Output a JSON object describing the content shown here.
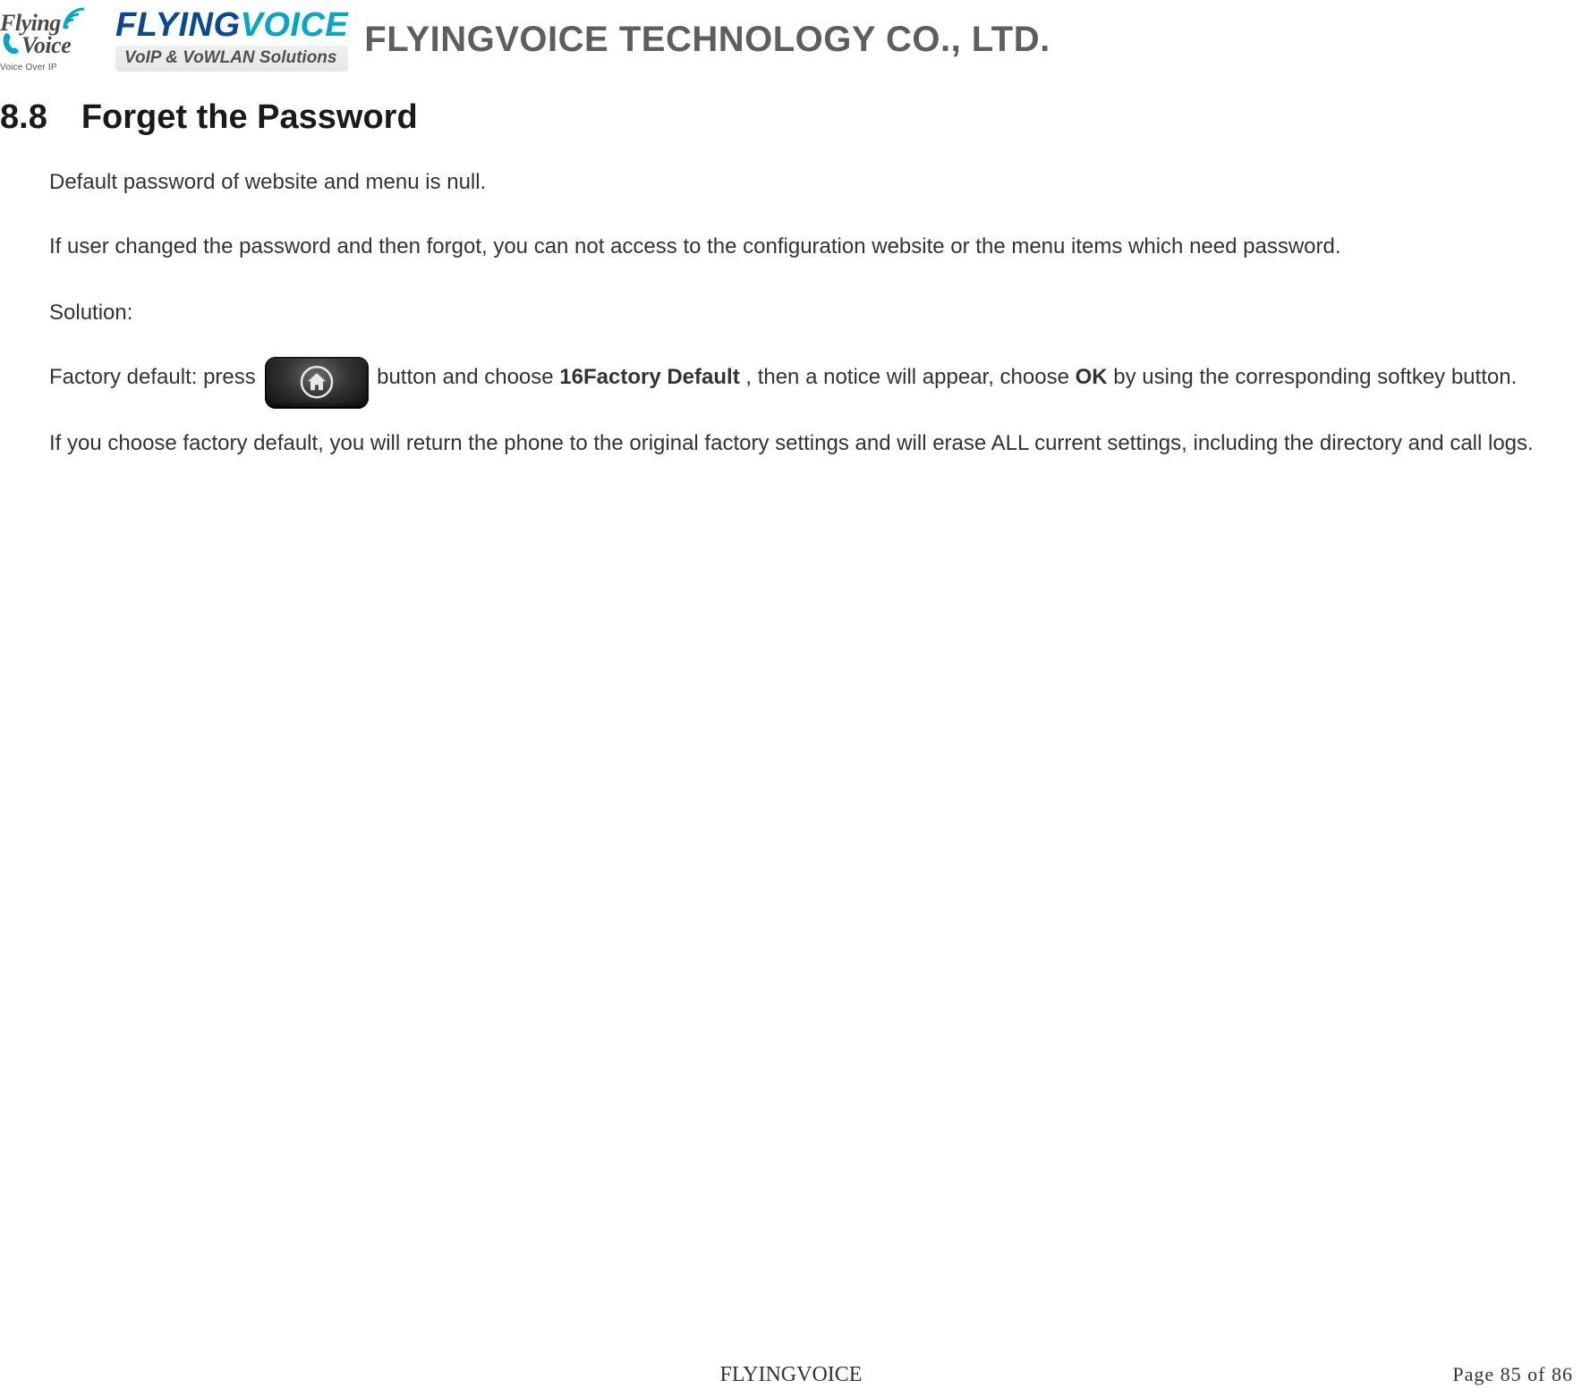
{
  "header": {
    "logo_mark": {
      "line1": "Flying",
      "line2": "Voice",
      "tagline": "Voice Over IP",
      "wifi_icon": "wifi-arcs-icon",
      "phone_icon": "phone-handset-icon"
    },
    "logo_word": {
      "part1": "FLYING",
      "part2": "VOICE",
      "strapline": "VoIP & VoWLAN Solutions"
    },
    "company_name": "FLYINGVOICE TECHNOLOGY CO., LTD."
  },
  "section": {
    "number": "8.8",
    "title": "Forget the Password"
  },
  "body": {
    "p1": "Default password of website and menu is null.",
    "p2": "If user changed the password and then forgot, you can not access to the configuration website or the menu items which need password.",
    "p3": "Solution:",
    "p4": {
      "pre_button": "Factory default: press ",
      "home_button_icon": "home-button-icon",
      "post_button_a": "button and choose ",
      "bold_1": "16Factory Default",
      "mid": ", then a notice will appear, choose ",
      "bold_2": "OK",
      "post_button_b": " by using the corresponding softkey button."
    },
    "p5": "If you choose factory default, you will return the phone to the original factory settings and will erase ALL current settings, including the directory and call logs."
  },
  "footer": {
    "center": "FLYINGVOICE",
    "page_label": "Page  85  of  86"
  }
}
